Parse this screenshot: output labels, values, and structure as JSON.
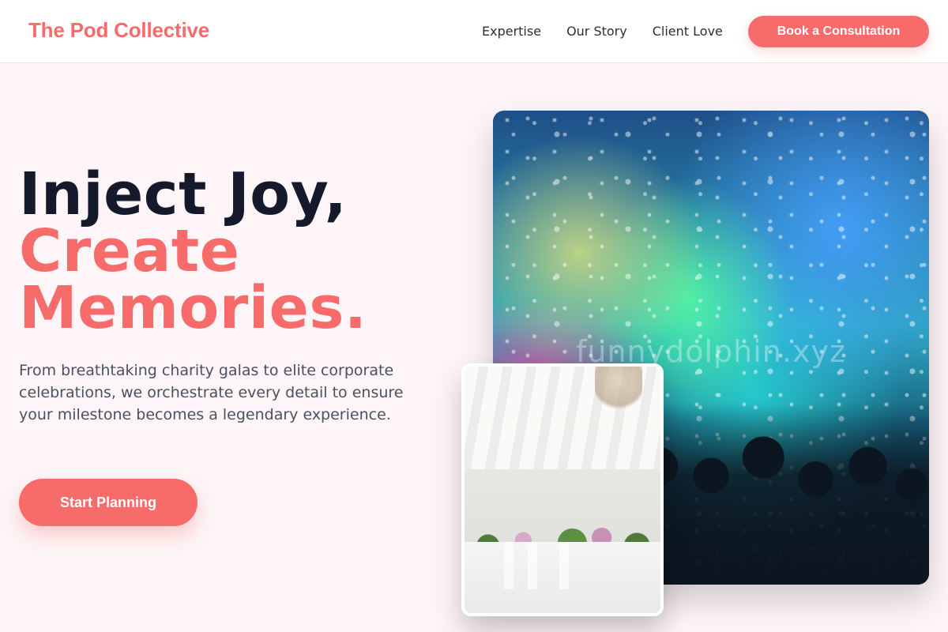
{
  "nav": {
    "logo": "The Pod Collective",
    "links": [
      "Expertise",
      "Our Story",
      "Client Love"
    ],
    "cta": "Book a Consultation"
  },
  "hero": {
    "title_line1": "Inject Joy,",
    "title_line2": "Create",
    "title_line3": "Memories.",
    "description": "From breathtaking charity galas to elite corporate celebrations, we orchestrate every detail to ensure your milestone becomes a legendary experience.",
    "button": "Start Planning"
  },
  "images": {
    "watermark": "funnydolphin.xyz"
  },
  "colors": {
    "accent": "#f76b6b",
    "heading": "#141a2b",
    "body": "#4b5160",
    "background": "#fdf5f7"
  }
}
